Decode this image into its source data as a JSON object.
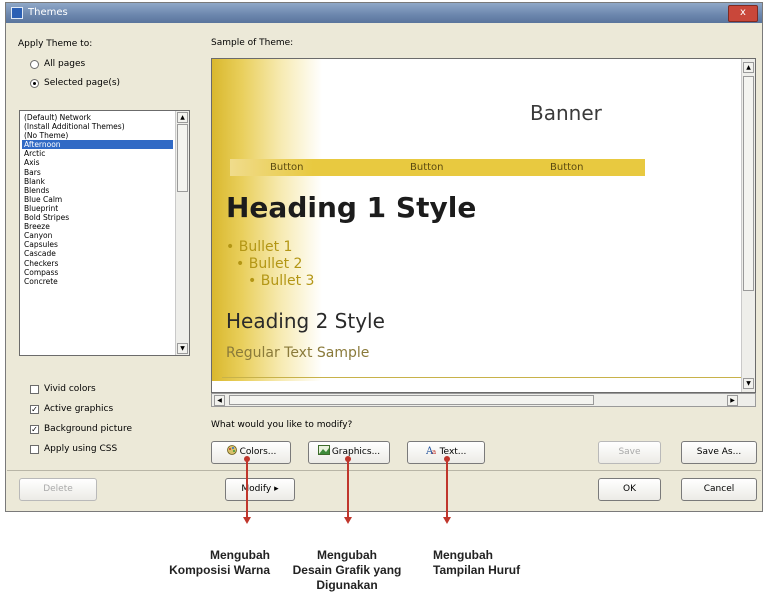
{
  "window": {
    "title": "Themes",
    "close_label": "x"
  },
  "left": {
    "apply_label": "Apply Theme to:",
    "radio_all": "All pages",
    "radio_selected": "Selected page(s)",
    "themes": [
      "(Default) Network",
      "(Install Additional Themes)",
      "(No Theme)",
      "Afternoon",
      "Arctic",
      "Axis",
      "Bars",
      "Blank",
      "Blends",
      "Blue Calm",
      "Blueprint",
      "Bold Stripes",
      "Breeze",
      "Canyon",
      "Capsules",
      "Cascade",
      "Checkers",
      "Compass",
      "Concrete"
    ],
    "selected_theme": "Afternoon",
    "options": [
      {
        "label": "Vivid colors",
        "checked": false
      },
      {
        "label": "Active graphics",
        "checked": true
      },
      {
        "label": "Background picture",
        "checked": true
      },
      {
        "label": "Apply using CSS",
        "checked": false
      }
    ]
  },
  "sample": {
    "label": "Sample of Theme:",
    "banner": "Banner",
    "buttons": [
      "Button",
      "Button",
      "Button"
    ],
    "heading1": "Heading 1 Style",
    "bullets": [
      "Bullet 1",
      "Bullet 2",
      "Bullet 3"
    ],
    "heading2": "Heading 2 Style",
    "regular": "Regular Text Sample"
  },
  "modify": {
    "label": "What would you like to modify?",
    "colors": "Colors...",
    "graphics": "Graphics...",
    "text": "Text...",
    "save": "Save",
    "save_as": "Save As..."
  },
  "footer": {
    "delete": "Delete",
    "modify": "Modify",
    "ok": "OK",
    "cancel": "Cancel"
  },
  "annotations": {
    "colors": [
      "Mengubah",
      "Komposisi Warna"
    ],
    "graphics": [
      "Mengubah",
      "Desain Grafik yang",
      "Digunakan"
    ],
    "text": [
      "Mengubah",
      "Tampilan Huruf"
    ]
  },
  "colors": {
    "accent": "#c0362c",
    "selection": "#316ac5",
    "theme_gold": "#e8c940"
  }
}
